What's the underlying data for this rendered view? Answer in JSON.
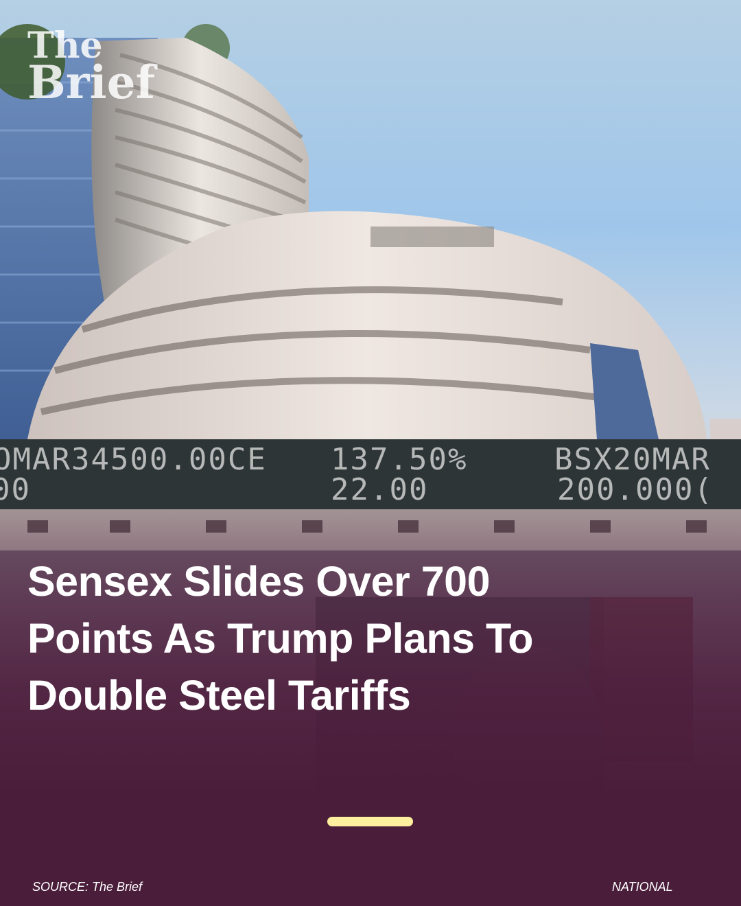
{
  "brand": {
    "line1": "The",
    "line2": "Brief"
  },
  "ticker": {
    "cells": [
      {
        "text": "OMAR34500.00CE"
      },
      {
        "text": "137.50%"
      },
      {
        "text": "BSX20MAR"
      },
      {
        "text": "00"
      },
      {
        "text": "22.00"
      },
      {
        "text": "200.000("
      }
    ]
  },
  "article": {
    "headline_line1": "Sensex Slides Over 700",
    "headline_line2": "Points As Trump Plans To",
    "headline_line3": "Double Steel Tariffs"
  },
  "footer": {
    "source": "SOURCE: The Brief",
    "category": "NATIONAL"
  },
  "colors": {
    "overlay": "#4a1d3a",
    "pager": "#fdf09e",
    "text": "#ffffff"
  }
}
